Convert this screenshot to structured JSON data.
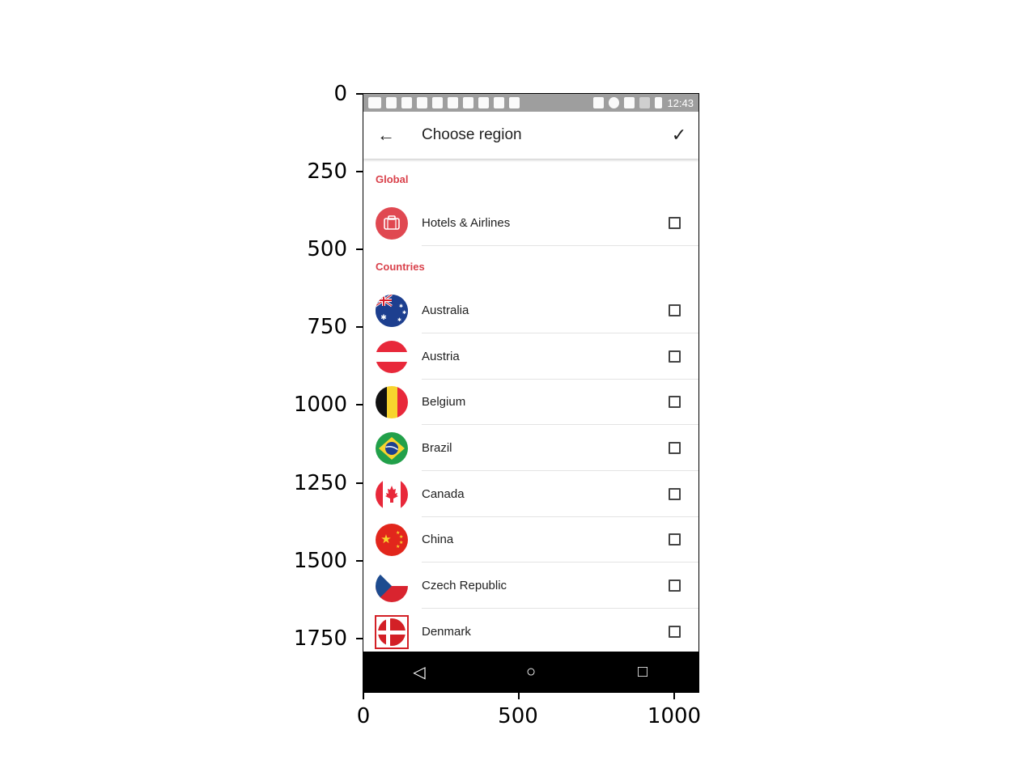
{
  "axes": {
    "y_ticks": [
      "0",
      "250",
      "500",
      "750",
      "1000",
      "1250",
      "1500",
      "1750"
    ],
    "x_ticks": [
      "0",
      "500",
      "1000"
    ]
  },
  "status_bar": {
    "time": "12:43"
  },
  "app_bar": {
    "title": "Choose region",
    "back_icon": "arrow-left-icon",
    "confirm_icon": "check-icon"
  },
  "sections": {
    "global": "Global",
    "countries": "Countries"
  },
  "global_items": [
    {
      "label": "Hotels & Airlines",
      "icon": "suitcase-icon",
      "checked": false
    }
  ],
  "countries": [
    {
      "label": "Australia",
      "checked": false
    },
    {
      "label": "Austria",
      "checked": false
    },
    {
      "label": "Belgium",
      "checked": false
    },
    {
      "label": "Brazil",
      "checked": false
    },
    {
      "label": "Canada",
      "checked": false
    },
    {
      "label": "China",
      "checked": false
    },
    {
      "label": "Czech Republic",
      "checked": false
    },
    {
      "label": "Denmark",
      "checked": false
    }
  ],
  "nav_bar": {
    "back": "◁",
    "home": "○",
    "recents": "□"
  },
  "colors": {
    "accent": "#d9414b",
    "status_bar": "#9e9e9e",
    "nav_bar": "#000000"
  }
}
